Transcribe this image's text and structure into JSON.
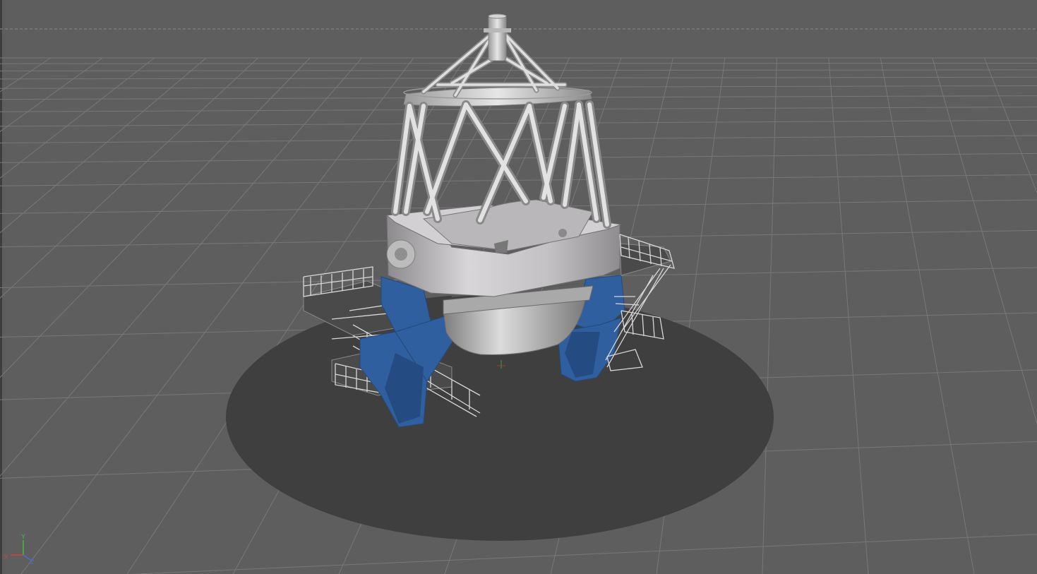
{
  "viewport": {
    "background_color": "#5e5e5e",
    "grid_color": "#787878",
    "floor_shadow_color": "#3f3f3f"
  },
  "model": {
    "mount_color": "#2f5f9e",
    "structure_color": "#c9c9c9",
    "platform_color": "#4a4a4a"
  },
  "axis_gizmo": {
    "x_label": "X",
    "y_label": "Y",
    "z_label": "Z",
    "x_color": "#d04040",
    "y_color": "#40c040",
    "z_color": "#4a6ad8"
  }
}
